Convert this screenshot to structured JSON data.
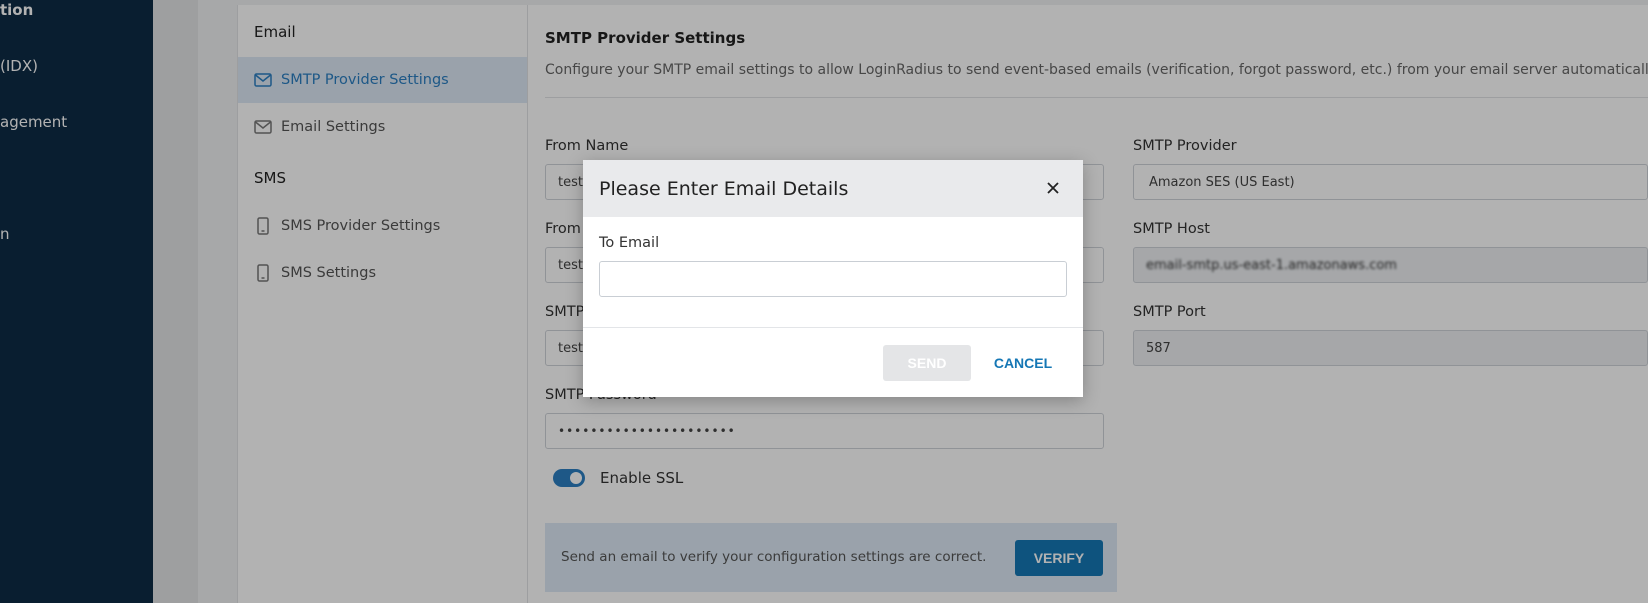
{
  "sidebar": {
    "items": [
      {
        "label": "tion"
      },
      {
        "label": "(IDX)"
      },
      {
        "label": "agement"
      },
      {
        "label": "n"
      }
    ]
  },
  "subnav": {
    "email_section": "Email",
    "email_items": [
      {
        "label": "SMTP Provider Settings",
        "icon": "mail-icon",
        "active": true
      },
      {
        "label": "Email Settings",
        "icon": "mail-icon",
        "active": false
      }
    ],
    "sms_section": "SMS",
    "sms_items": [
      {
        "label": "SMS Provider Settings",
        "icon": "phone-icon",
        "active": false
      },
      {
        "label": "SMS Settings",
        "icon": "phone-icon",
        "active": false
      }
    ]
  },
  "main": {
    "title": "SMTP Provider Settings",
    "description": "Configure your SMTP email settings to allow LoginRadius to send event-based emails (verification, forgot password, etc.) from your email server automatically.",
    "from_name_label": "From Name",
    "from_name_value": "test",
    "from_email_label": "From",
    "from_email_value": "test",
    "smtp_user_label": "SMTP",
    "smtp_user_value": "test",
    "smtp_password_label": "SMTP Password",
    "smtp_password_value": "••••••••••••••••••••••",
    "smtp_provider_label": "SMTP Provider",
    "smtp_provider_value": "Amazon SES (US East)",
    "smtp_host_label": "SMTP Host",
    "smtp_host_value": "email-smtp.us-east-1.amazonaws.com",
    "smtp_port_label": "SMTP Port",
    "smtp_port_value": "587",
    "enable_ssl_label": "Enable SSL",
    "enable_ssl": true,
    "verify_text": "Send an email to verify your configuration settings are correct.",
    "verify_button": "VERIFY"
  },
  "modal": {
    "title": "Please Enter Email Details",
    "to_email_label": "To Email",
    "to_email_value": "",
    "send_button": "SEND",
    "cancel_button": "CANCEL"
  },
  "colors": {
    "sidebar_bg": "#0d2b45",
    "accent": "#1577b5",
    "active_bg": "#dde9f5"
  }
}
